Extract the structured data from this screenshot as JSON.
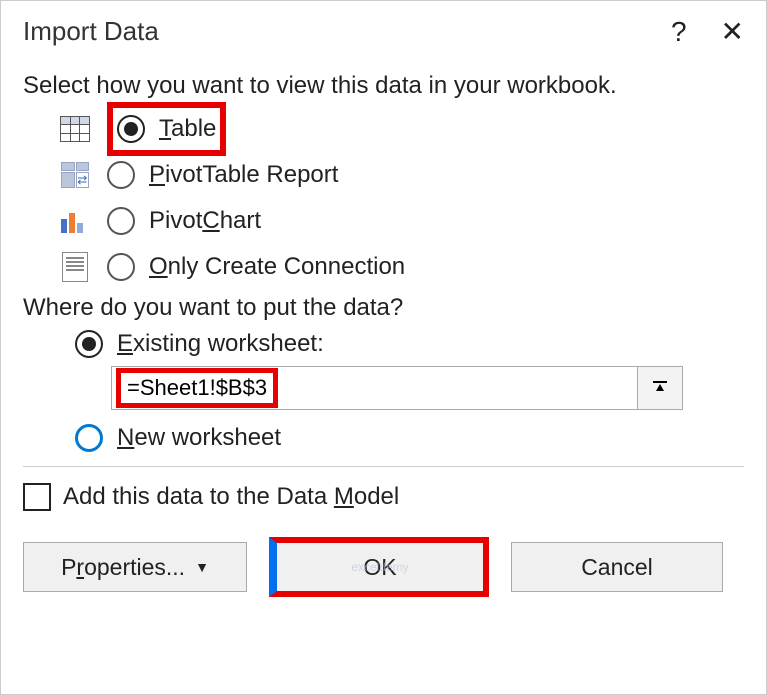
{
  "dialog": {
    "title": "Import Data",
    "help_symbol": "?",
    "close_symbol": "✕"
  },
  "section1_label": "Select how you want to view this data in your workbook.",
  "view_options": {
    "table": {
      "pre": "",
      "u": "T",
      "post": "able"
    },
    "pivot_table": {
      "pre": "",
      "u": "P",
      "post": "ivotTable Report"
    },
    "pivot_chart": {
      "pre": "Pivot",
      "u": "C",
      "post": "hart"
    },
    "connection": {
      "pre": "",
      "u": "O",
      "post": "nly Create Connection"
    }
  },
  "section2_label": "Where do you want to put the data?",
  "location": {
    "existing": {
      "pre": "",
      "u": "E",
      "post": "xisting worksheet:"
    },
    "value": "=Sheet1!$B$3",
    "new": {
      "pre": "",
      "u": "N",
      "post": "ew worksheet"
    }
  },
  "datamodel": {
    "pre": "Add this data to the Data ",
    "u": "M",
    "post": "odel"
  },
  "buttons": {
    "properties": {
      "pre": "P",
      "u": "r",
      "post": "operties..."
    },
    "ok": "OK",
    "cancel": "Cancel"
  },
  "watermark": "exceldemy"
}
